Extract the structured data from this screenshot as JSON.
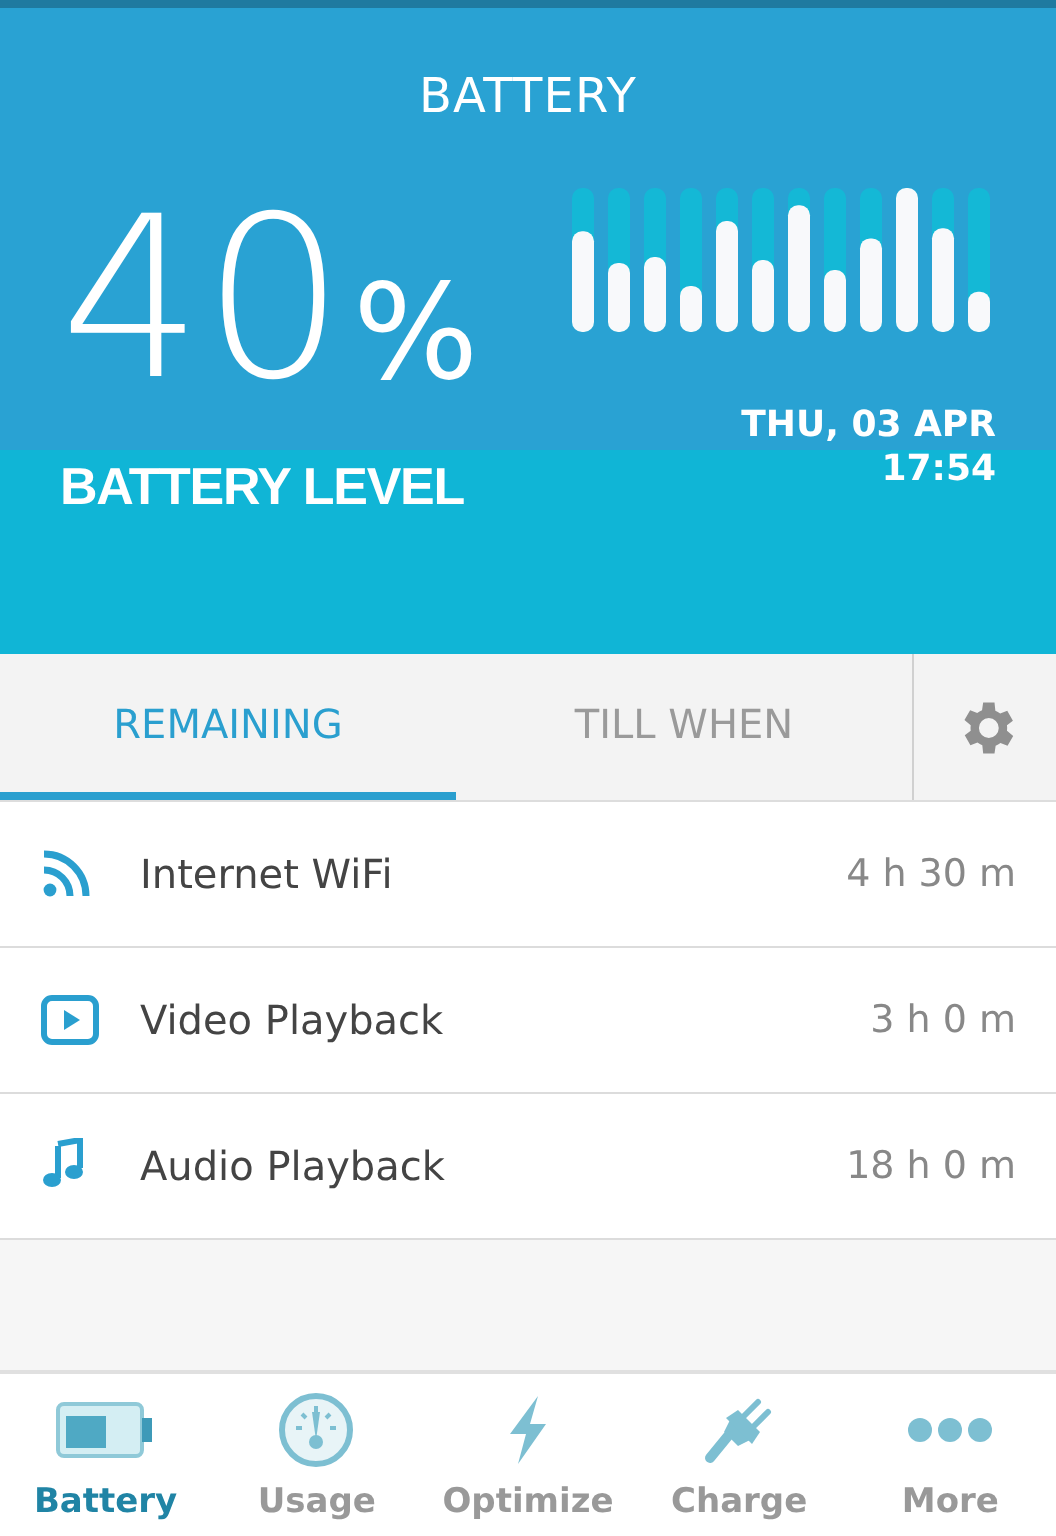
{
  "header": {
    "title": "BATTERY",
    "percent": "40",
    "percent_sign": "%",
    "caption": "BATTERY LEVEL",
    "date": "THU, 03 APR",
    "time": "17:54"
  },
  "tabs": [
    {
      "label": "REMAINING",
      "selected": true
    },
    {
      "label": "TILL WHEN",
      "selected": false
    }
  ],
  "items": [
    {
      "kind": "wifi",
      "label": "Internet WiFi",
      "value": "4 h 30 m"
    },
    {
      "kind": "video",
      "label": "Video Playback",
      "value": "3 h 0 m"
    },
    {
      "kind": "audio",
      "label": "Audio Playback",
      "value": "18 h 0 m"
    }
  ],
  "nav": [
    {
      "kind": "battery",
      "label": "Battery",
      "selected": true
    },
    {
      "kind": "usage",
      "label": "Usage",
      "selected": false
    },
    {
      "kind": "optimize",
      "label": "Optimize",
      "selected": false
    },
    {
      "kind": "charge",
      "label": "Charge",
      "selected": false
    },
    {
      "kind": "more",
      "label": "More",
      "selected": false
    }
  ]
}
